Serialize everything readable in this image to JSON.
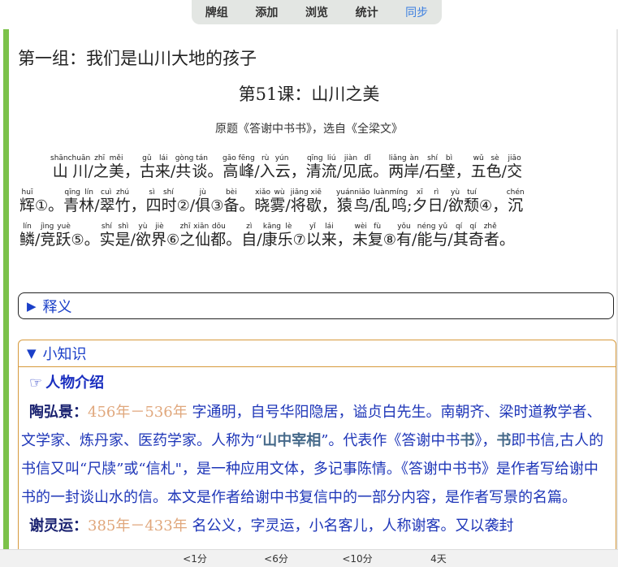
{
  "nav": {
    "items": [
      "牌组",
      "添加",
      "浏览",
      "统计",
      "同步"
    ],
    "active_index": 4
  },
  "group_title": "第一组：我们是山川大地的孩子",
  "lesson_title": "第51课：山川之美",
  "source": "原题《答谢中书书》，选自《全梁文》",
  "poem": {
    "lines": [
      [
        {
          "t": "山川",
          "p": "shānchuān"
        },
        {
          "t": "/"
        },
        {
          "t": "之美",
          "p": "zhī měi"
        },
        {
          "t": "，"
        },
        {
          "t": "古来",
          "p": "gǔ lái"
        },
        {
          "t": "/"
        },
        {
          "t": "共谈",
          "p": "gòng tán"
        },
        {
          "t": "。"
        },
        {
          "t": "高峰",
          "p": "gāo fēng"
        },
        {
          "t": "/"
        },
        {
          "t": "入云",
          "p": "rù yún"
        },
        {
          "t": "，"
        },
        {
          "t": "清流",
          "p": "qīng liú"
        },
        {
          "t": "/"
        },
        {
          "t": "见底",
          "p": "jiàn dǐ"
        },
        {
          "t": "。"
        },
        {
          "t": "两岸",
          "p": "liǎng àn"
        },
        {
          "t": "/"
        },
        {
          "t": "石壁",
          "p": "shí bì"
        },
        {
          "t": "，"
        },
        {
          "t": "五色",
          "p": "wǔ sè"
        },
        {
          "t": "/"
        },
        {
          "t": "交",
          "p": "jiāo"
        }
      ],
      [
        {
          "t": "辉",
          "p": "huī"
        },
        {
          "t": "①",
          "c": 1
        },
        {
          "t": "。"
        },
        {
          "t": "青林",
          "p": "qīng lín"
        },
        {
          "t": "/"
        },
        {
          "t": "翠竹",
          "p": "cuì zhú"
        },
        {
          "t": "，"
        },
        {
          "t": "四时",
          "p": "sì shí"
        },
        {
          "t": "②",
          "c": 1
        },
        {
          "t": "/"
        },
        {
          "t": "俱",
          "p": "jù"
        },
        {
          "t": "③",
          "c": 1
        },
        {
          "t": "备",
          "p": "bèi"
        },
        {
          "t": "。"
        },
        {
          "t": "晓雾",
          "p": "xiǎo wù"
        },
        {
          "t": "/"
        },
        {
          "t": "将歇",
          "p": "jiāng xiē"
        },
        {
          "t": "，"
        },
        {
          "t": "猿鸟",
          "p": "yuánniǎo"
        },
        {
          "t": "/"
        },
        {
          "t": "乱鸣",
          "p": "luànmíng"
        },
        {
          "t": ";"
        },
        {
          "t": "夕日",
          "p": "xī rì"
        },
        {
          "t": "/"
        },
        {
          "t": "欲颓",
          "p": "yù tuí"
        },
        {
          "t": "④",
          "c": 1
        },
        {
          "t": "，"
        },
        {
          "t": "沉",
          "p": "chén"
        }
      ],
      [
        {
          "t": "鳞",
          "p": "lín"
        },
        {
          "t": "/"
        },
        {
          "t": "竞跃",
          "p": "jìng yuè"
        },
        {
          "t": "⑤",
          "c": 1
        },
        {
          "t": "。"
        },
        {
          "t": "实是",
          "p": "shí shì"
        },
        {
          "t": "/"
        },
        {
          "t": "欲界",
          "p": "yù jiè"
        },
        {
          "t": "⑥",
          "c": 1
        },
        {
          "t": "之仙都",
          "p": "zhī xiān dōu"
        },
        {
          "t": "。"
        },
        {
          "t": "自",
          "p": "zì"
        },
        {
          "t": "/"
        },
        {
          "t": "康乐",
          "p": "kāng lè"
        },
        {
          "t": "⑦",
          "c": 1
        },
        {
          "t": "以来",
          "p": "yǐ lái"
        },
        {
          "t": "，"
        },
        {
          "t": "未复",
          "p": "wèi fù"
        },
        {
          "t": "⑧",
          "c": 1
        },
        {
          "t": "有",
          "p": "yǒu"
        },
        {
          "t": "/"
        },
        {
          "t": "能与",
          "p": "néng yǔ"
        },
        {
          "t": "/"
        },
        {
          "t": "其奇者",
          "p": "qí qí zhě"
        },
        {
          "t": "。"
        }
      ]
    ]
  },
  "section_meaning": {
    "label": "释义",
    "expanded": false
  },
  "section_knowledge": {
    "label": "小知识",
    "expanded": true,
    "sub_title_icon": "pointing-hand-icon",
    "sub_title": "人物介绍",
    "bio1": {
      "name": "陶弘景",
      "colon": "：",
      "years": "456年－536年",
      "text_a": " 字通明，自号华阳隐居，谥贞白先生。南朝齐、梁时道教学者、文学家、炼丹家、医药学家。人称为“",
      "kw1": "山中宰相",
      "text_b": "”。代表作《答谢中书",
      "kw2": "书",
      "text_c": "》，",
      "kw3": "书",
      "text_d": "即书信,古人的书信又叫“尺牍”或“信札\"，是一种应用文体，多记事陈情。《答谢中书书》是作者写给谢中书的一封谈山水的信。本文是作者给谢中书复信中的一部分内容，是作者写景的名篇。"
    },
    "bio2": {
      "name": "谢灵运",
      "colon": "：",
      "years": "385年－433年",
      "text_a": " 名公义，字灵运，小名客儿，人称谢客。又以袭封"
    }
  },
  "bottom_buttons": [
    "<1分",
    "<6分",
    "<10分",
    "4天"
  ],
  "colors": {
    "accent_green": "#7cc24a",
    "section_blue": "#1a3fc8",
    "knowledge_border": "#d79a3c",
    "years": "#e0a77c",
    "sync_active": "#3b7fe0"
  }
}
